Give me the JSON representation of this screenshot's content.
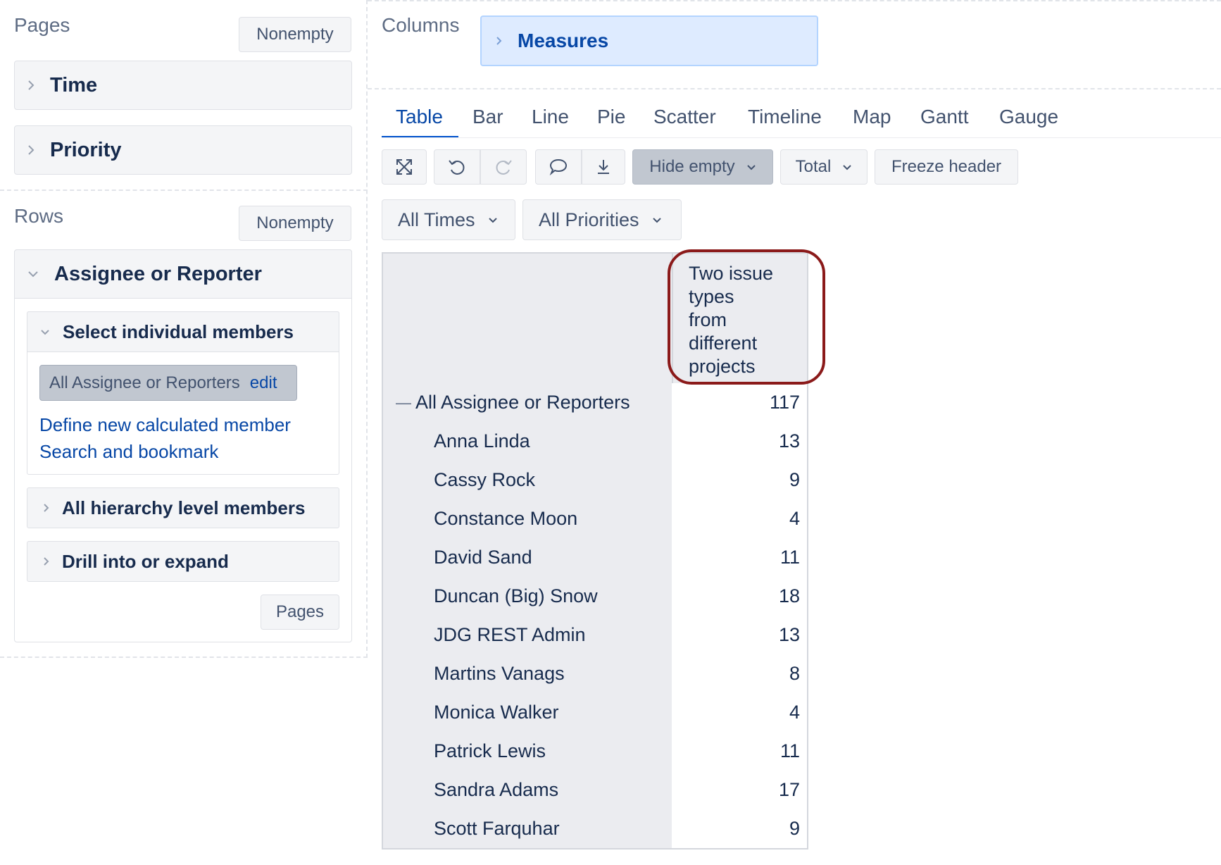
{
  "left": {
    "pages": {
      "title": "Pages",
      "nonempty_label": "Nonempty",
      "dimensions": [
        {
          "label": "Time"
        },
        {
          "label": "Priority"
        }
      ]
    },
    "rows": {
      "title": "Rows",
      "nonempty_label": "Nonempty",
      "dimension": "Assignee or Reporter",
      "select_section": "Select individual members",
      "selected_member": "All Assignee or Reporters",
      "edit_label": "edit",
      "define_link": "Define new calculated member",
      "search_link": "Search and bookmark",
      "hierarchy_section": "All hierarchy level members",
      "drill_section": "Drill into or expand",
      "pages_button": "Pages"
    }
  },
  "columns": {
    "title": "Columns",
    "measures_label": "Measures"
  },
  "tabs": [
    "Table",
    "Bar",
    "Line",
    "Pie",
    "Scatter",
    "Timeline",
    "Map",
    "Gantt",
    "Gauge"
  ],
  "active_tab": "Table",
  "toolbar": {
    "hide_empty": "Hide empty",
    "total": "Total",
    "freeze_header": "Freeze header"
  },
  "filters": {
    "times": "All Times",
    "priorities": "All Priorities"
  },
  "table": {
    "column_header": [
      "Two issue",
      "types",
      "from",
      "different",
      "projects"
    ],
    "total_row": {
      "label": "All Assignee or Reporters",
      "value": "117",
      "toggle": "—"
    },
    "rows": [
      {
        "label": "Anna Linda",
        "value": "13"
      },
      {
        "label": "Cassy Rock",
        "value": "9"
      },
      {
        "label": "Constance Moon",
        "value": "4"
      },
      {
        "label": "David Sand",
        "value": "11"
      },
      {
        "label": "Duncan (Big) Snow",
        "value": "18"
      },
      {
        "label": "JDG REST Admin",
        "value": "13"
      },
      {
        "label": "Martins Vanags",
        "value": "8"
      },
      {
        "label": "Monica Walker",
        "value": "4"
      },
      {
        "label": "Patrick Lewis",
        "value": "11"
      },
      {
        "label": "Sandra Adams",
        "value": "17"
      },
      {
        "label": "Scott Farquhar",
        "value": "9"
      }
    ]
  },
  "colors": {
    "accent": "#0747a6",
    "highlight_outline": "#8b1a1a"
  }
}
